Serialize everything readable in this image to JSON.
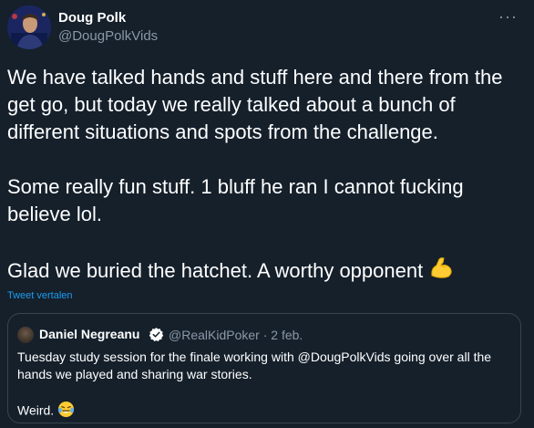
{
  "author": {
    "display_name": "Doug Polk",
    "handle": "@DougPolkVids"
  },
  "tweet": {
    "paragraph_1": "We have talked hands and stuff here and there from the get go, but today we really talked about a bunch of different situations and spots from the challenge.",
    "paragraph_2": "Some really fun stuff. 1 bluff he ran I cannot fucking believe lol.",
    "paragraph_3": "Glad we buried the hatchet. A worthy opponent",
    "paragraph_3_emoji": "flexed-biceps-icon",
    "translate_label": "Tweet vertalen"
  },
  "quoted_tweet": {
    "display_name": "Daniel Negreanu",
    "handle": "@RealKidPoker",
    "separator": "·",
    "date": "2 feb.",
    "line_1": "Tuesday study session for the finale working with @DougPolkVids going over all the hands we played and sharing war stories.",
    "line_2": "Weird.",
    "line_2_emoji": "laughing-tears-icon"
  },
  "colors": {
    "background": "#15202b",
    "text": "#ffffff",
    "secondary_text": "#8b98a5",
    "link": "#1d9bf0",
    "border": "#38444d"
  }
}
